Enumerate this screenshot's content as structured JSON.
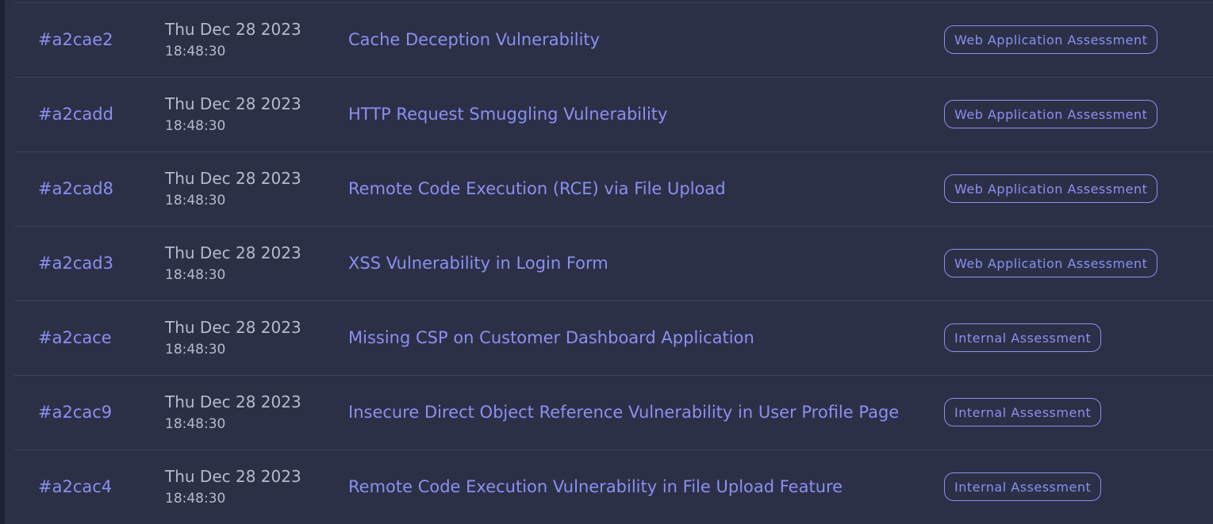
{
  "findings": [
    {
      "id": "#a2cae2",
      "date": "Thu Dec 28 2023",
      "time": "18:48:30",
      "title": "Cache Deception Vulnerability",
      "tag": "Web Application Assessment"
    },
    {
      "id": "#a2cadd",
      "date": "Thu Dec 28 2023",
      "time": "18:48:30",
      "title": "HTTP Request Smuggling Vulnerability",
      "tag": "Web Application Assessment"
    },
    {
      "id": "#a2cad8",
      "date": "Thu Dec 28 2023",
      "time": "18:48:30",
      "title": "Remote Code Execution (RCE) via File Upload",
      "tag": "Web Application Assessment"
    },
    {
      "id": "#a2cad3",
      "date": "Thu Dec 28 2023",
      "time": "18:48:30",
      "title": "XSS Vulnerability in Login Form",
      "tag": "Web Application Assessment"
    },
    {
      "id": "#a2cace",
      "date": "Thu Dec 28 2023",
      "time": "18:48:30",
      "title": "Missing CSP on Customer Dashboard Application",
      "tag": "Internal Assessment"
    },
    {
      "id": "#a2cac9",
      "date": "Thu Dec 28 2023",
      "time": "18:48:30",
      "title": "Insecure Direct Object Reference Vulnerability in User Profile Page",
      "tag": "Internal Assessment"
    },
    {
      "id": "#a2cac4",
      "date": "Thu Dec 28 2023",
      "time": "18:48:30",
      "title": "Remote Code Execution Vulnerability in File Upload Feature",
      "tag": "Internal Assessment"
    }
  ],
  "colors": {
    "background": "#2b3046",
    "accent": "#8b8ff0",
    "muted_text": "#b6bacb",
    "divider": "#3c4259"
  }
}
